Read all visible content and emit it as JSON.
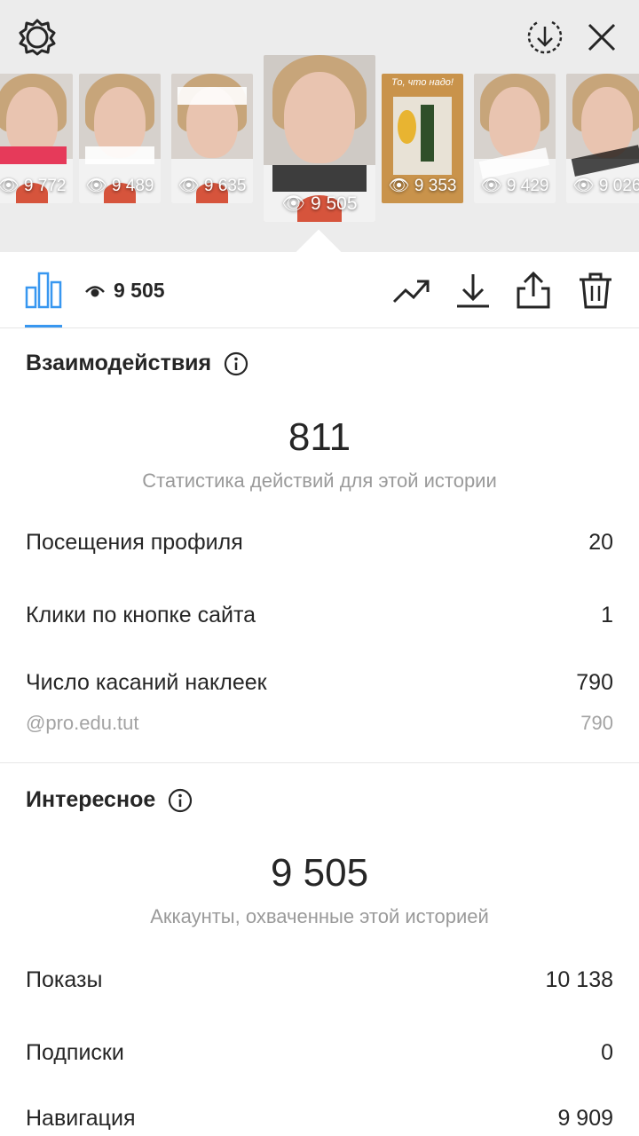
{
  "header": {
    "icons": [
      "settings-gear-icon",
      "save-download-circle-icon",
      "close-x-icon"
    ]
  },
  "stories": [
    {
      "views": "9 772",
      "caption": "@pro.edu.tut",
      "bg": "#d9d4cf"
    },
    {
      "views": "9 489",
      "caption": "",
      "bg": "#d6d1cc"
    },
    {
      "views": "9 635",
      "caption": "",
      "bg": "#d8d2cd"
    },
    {
      "views": "9 505",
      "caption": "",
      "bg": "#cfcac5",
      "selected": true
    },
    {
      "views": "9 353",
      "caption": "То, что надо!",
      "bg": "#c9934b"
    },
    {
      "views": "9 429",
      "caption": "",
      "bg": "#d7d2cd"
    },
    {
      "views": "9 026",
      "caption": "",
      "bg": "#d5cfca"
    }
  ],
  "action_bar": {
    "view_count": "9 505",
    "icons": [
      "insights-chart-icon",
      "eye-icon",
      "trend-icon",
      "download-icon",
      "share-icon",
      "trash-icon"
    ],
    "accent": "#3897f0"
  },
  "interactions": {
    "title": "Взаимодействия",
    "total": "811",
    "caption": "Статистика действий для этой истории",
    "rows": [
      {
        "label": "Посещения профиля",
        "value": "20"
      },
      {
        "label": "Клики по кнопке сайта",
        "value": "1"
      },
      {
        "label": "Число касаний наклеек",
        "value": "790"
      }
    ],
    "sub_row": {
      "label": "@pro.edu.tut",
      "value": "790"
    }
  },
  "discovery": {
    "title": "Интересное",
    "total": "9 505",
    "caption": "Аккаунты, охваченные этой историей",
    "rows": [
      {
        "label": "Показы",
        "value": "10 138"
      },
      {
        "label": "Подписки",
        "value": "0"
      },
      {
        "label": "Навигация",
        "value": "9 909"
      }
    ]
  }
}
